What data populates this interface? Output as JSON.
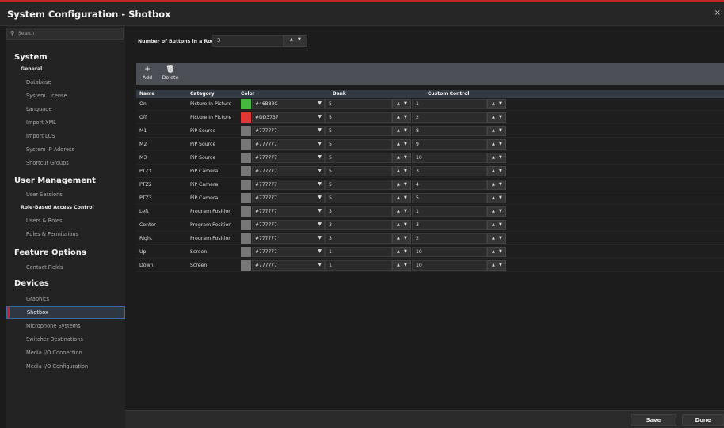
{
  "window": {
    "title": "System Configuration - Shotbox",
    "close_glyph": "×"
  },
  "sidebar": {
    "search_placeholder": "Search",
    "system_title": "System",
    "general_title": "General",
    "general_items": [
      "Database",
      "System License",
      "Language",
      "Import XML",
      "Import LCS",
      "System IP Address",
      "Shortcut Groups"
    ],
    "user_mgmt_title": "User Management",
    "user_sessions": "User Sessions",
    "rbac_title": "Role-Based Access Control",
    "rbac_items": [
      "Users & Roles",
      "Roles & Permissions"
    ],
    "feature_title": "Feature Options",
    "feature_items": [
      "Contact Fields"
    ],
    "devices_title": "Devices",
    "devices_items": [
      "Graphics",
      "Shotbox",
      "Microphone Systems",
      "Switcher Destinations",
      "Media I/O Connection",
      "Media I/O Configuration"
    ],
    "active_item": "Shotbox"
  },
  "main": {
    "nbr_label": "Number of Buttons in a Row",
    "nbr_value": "3",
    "toolbar": {
      "add_label": "Add",
      "delete_label": "Delete"
    },
    "columns": [
      "Name",
      "Category",
      "Color",
      "Bank",
      "Custom Control"
    ],
    "rows": [
      {
        "name": "On",
        "category": "Picture In Picture",
        "color": "#46B83C",
        "bank": "5",
        "custom": "1"
      },
      {
        "name": "Off",
        "category": "Picture In Picture",
        "color": "#DD3737",
        "bank": "5",
        "custom": "2"
      },
      {
        "name": "M1",
        "category": "PiP Source",
        "color": "#777777",
        "bank": "5",
        "custom": "8"
      },
      {
        "name": "M2",
        "category": "PiP Source",
        "color": "#777777",
        "bank": "5",
        "custom": "9"
      },
      {
        "name": "M3",
        "category": "PiP Source",
        "color": "#777777",
        "bank": "5",
        "custom": "10"
      },
      {
        "name": "PTZ1",
        "category": "PiP Camera",
        "color": "#777777",
        "bank": "5",
        "custom": "3"
      },
      {
        "name": "PTZ2",
        "category": "PiP Camera",
        "color": "#777777",
        "bank": "5",
        "custom": "4"
      },
      {
        "name": "PTZ3",
        "category": "PiP Camera",
        "color": "#777777",
        "bank": "5",
        "custom": "5"
      },
      {
        "name": "Left",
        "category": "Program Position",
        "color": "#777777",
        "bank": "3",
        "custom": "1"
      },
      {
        "name": "Center",
        "category": "Program Position",
        "color": "#777777",
        "bank": "3",
        "custom": "3"
      },
      {
        "name": "Right",
        "category": "Program Position",
        "color": "#777777",
        "bank": "3",
        "custom": "2"
      },
      {
        "name": "Up",
        "category": "Screen",
        "color": "#777777",
        "bank": "1",
        "custom": "10"
      },
      {
        "name": "Down",
        "category": "Screen",
        "color": "#777777",
        "bank": "1",
        "custom": "10"
      }
    ]
  },
  "footer": {
    "save_label": "Save",
    "done_label": "Done"
  },
  "colors": {
    "accent": "#c8232c",
    "selection_border": "#3c6a9c",
    "table_header": "#343a44"
  }
}
